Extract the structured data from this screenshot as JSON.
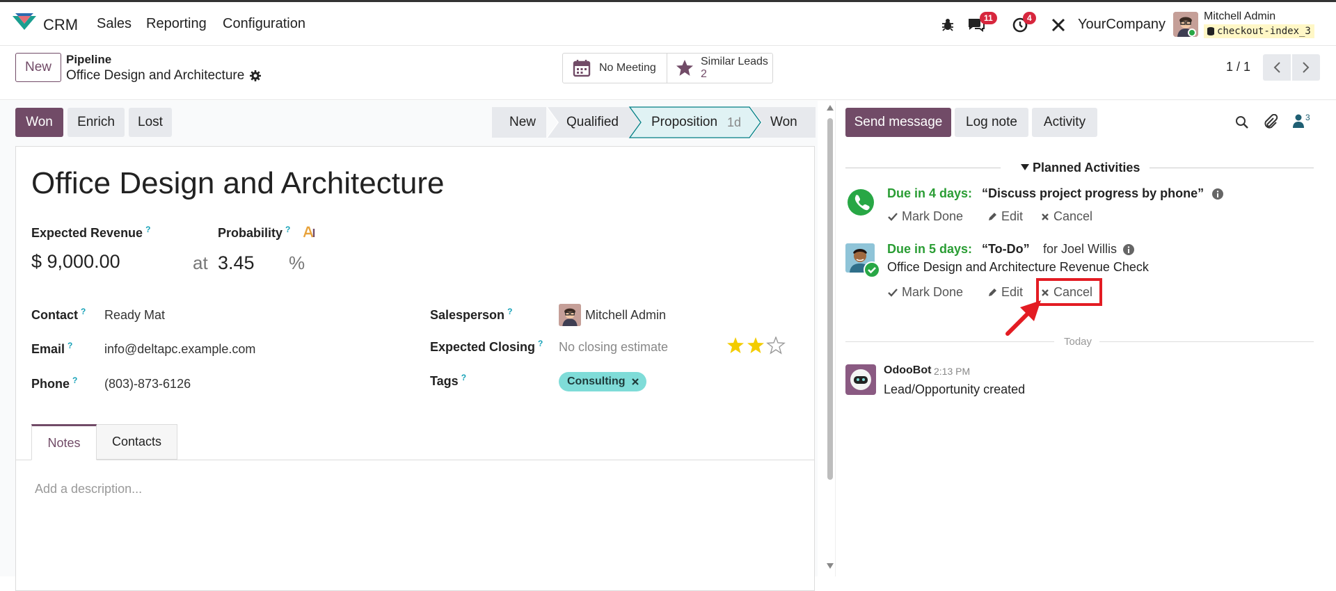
{
  "nav": {
    "app_name": "CRM",
    "menu": [
      "Sales",
      "Reporting",
      "Configuration"
    ],
    "messages_badge": "11",
    "activities_badge": "4",
    "company": "YourCompany",
    "user_name": "Mitchell Admin",
    "database": "checkout-index_3"
  },
  "control_panel": {
    "new_label": "New",
    "breadcrumb_parent": "Pipeline",
    "breadcrumb_current": "Office Design and Architecture",
    "meeting_label": "No Meeting",
    "similar_label": "Similar Leads",
    "similar_count": "2",
    "pager": "1 / 1"
  },
  "statusbar": {
    "won_label": "Won",
    "enrich_label": "Enrich",
    "lost_label": "Lost",
    "stages": [
      {
        "label": "New"
      },
      {
        "label": "Qualified"
      },
      {
        "label": "Proposition",
        "duration": "1d"
      },
      {
        "label": "Won"
      }
    ]
  },
  "form": {
    "title": "Office Design and Architecture",
    "revenue_label": "Expected Revenue",
    "revenue_value": "$ 9,000.00",
    "at_label": "at",
    "probability_label": "Probability",
    "probability_value": "3.45",
    "percent_sign": "%",
    "contact_label": "Contact",
    "contact_value": "Ready Mat",
    "email_label": "Email",
    "email_value": "info@deltapc.example.com",
    "phone_label": "Phone",
    "phone_value": "(803)-873-6126",
    "salesperson_label": "Salesperson",
    "salesperson_value": "Mitchell Admin",
    "closing_label": "Expected Closing",
    "closing_placeholder": "No closing estimate",
    "priority_stars": 2,
    "priority_max": 3,
    "tags_label": "Tags",
    "tag": "Consulting",
    "tabs": [
      "Notes",
      "Contacts"
    ],
    "description_placeholder": "Add a description..."
  },
  "chatter": {
    "send_label": "Send message",
    "log_label": "Log note",
    "activity_label": "Activity",
    "followers_count": "3",
    "planned_header": "Planned Activities",
    "activities": [
      {
        "due": "Due in 4 days:",
        "summary": "“Discuss project progress by phone”",
        "mark_done": "Mark Done",
        "edit": "Edit",
        "cancel": "Cancel"
      },
      {
        "due": "Due in 5 days:",
        "summary": "“To-Do”",
        "assignee": "for Joel Willis",
        "note": "Office Design and Architecture Revenue Check",
        "mark_done": "Mark Done",
        "edit": "Edit",
        "cancel": "Cancel"
      }
    ],
    "date_separator": "Today",
    "message": {
      "author": "OdooBot",
      "time": "2:13 PM",
      "body": "Lead/Opportunity created"
    }
  },
  "colors": {
    "brand": "#714b67",
    "stage_active": "#e0f2f4",
    "stage_active_border": "#017e84",
    "due_green": "#2a9d34",
    "tag_bg": "#7fdcd8",
    "highlight_red": "#e31c23"
  }
}
